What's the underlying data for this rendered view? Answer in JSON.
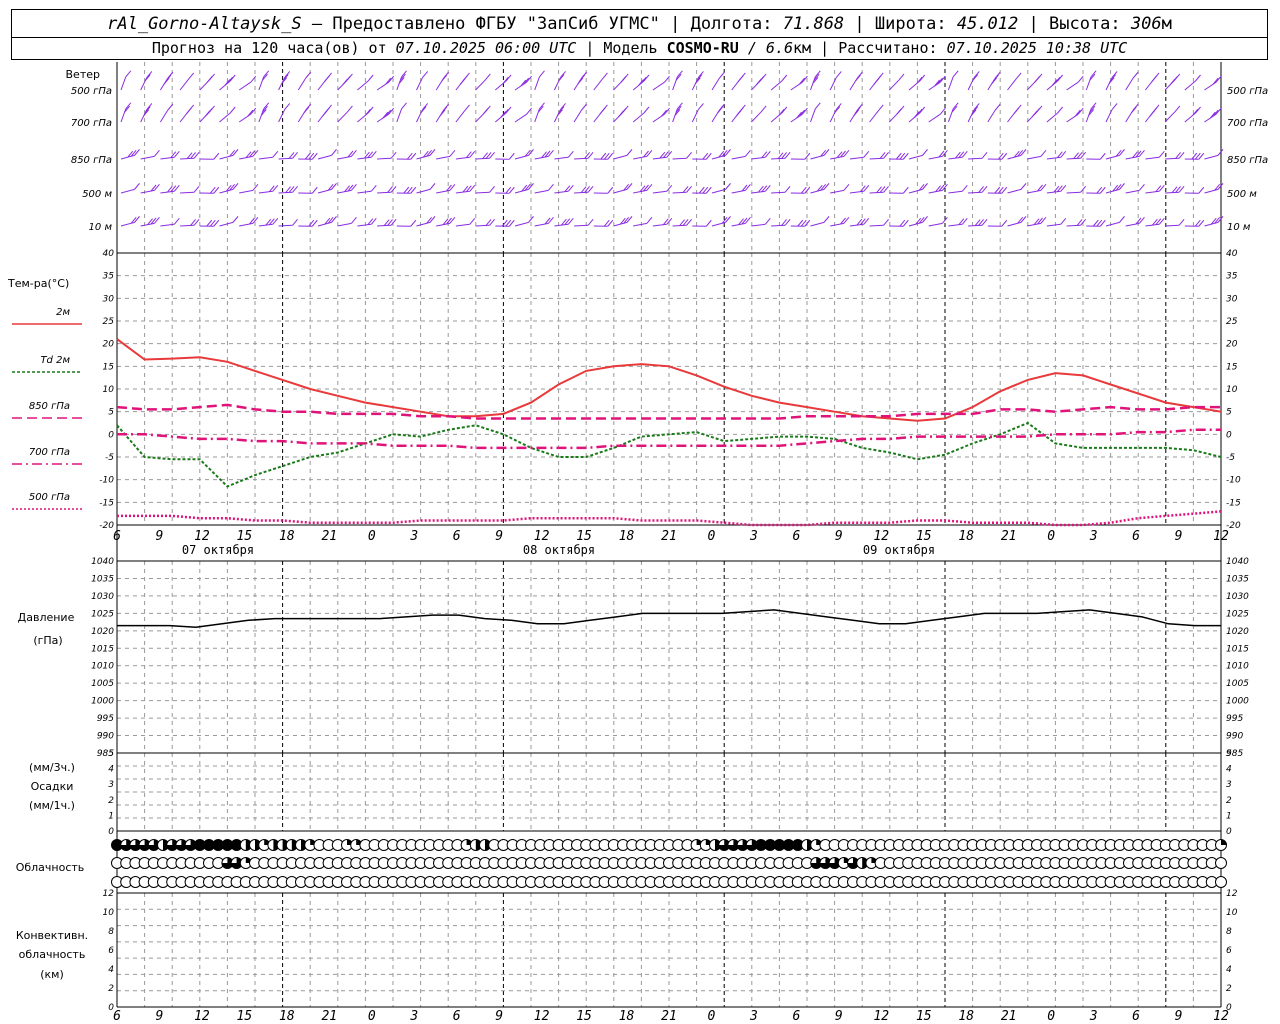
{
  "header": {
    "station": "rAl_Gorno-Altaysk_S",
    "dash": "–",
    "provider": "Предоставлено ФГБУ \"ЗапСиб УГМС\"",
    "lon_label": "Долгота:",
    "lon_value": "71.868",
    "lat_label": "Широта:",
    "lat_value": "45.012",
    "alt_label": "Высота:",
    "alt_value": "306",
    "alt_unit": "м",
    "forecast_label": "Прогноз на 120 часа(ов) от",
    "forecast_start": "07.10.2025 06:00 UTC",
    "model_label": "Модель",
    "model_name": "COSMO-RU",
    "model_res": "/ 6.6",
    "model_res_unit": "км",
    "calc_label": "Рассчитано:",
    "calc_time": "07.10.2025 10:38 UTC",
    "sep": "|"
  },
  "panels": {
    "wind": {
      "title": "Ветер",
      "levels": [
        "500 гПа",
        "700 гПа",
        "850 гПа",
        "500 м",
        "10 м"
      ]
    },
    "temperature": {
      "title": "Тем-ра(°C)",
      "legend": [
        {
          "label": "2м",
          "color": "#e8393b",
          "style": "solid"
        },
        {
          "label": "Td  2м",
          "color": "#1a7a1a",
          "style": "dotted"
        },
        {
          "label": "850 гПа",
          "color": "#e0137a",
          "style": "dashed"
        },
        {
          "label": "700 гПа",
          "color": "#e0137a",
          "style": "dashdot"
        },
        {
          "label": "500 гПа",
          "color": "#e0137a",
          "style": "dot"
        }
      ],
      "yticks": [
        "40",
        "35",
        "30",
        "25",
        "20",
        "15",
        "10",
        "5",
        "0",
        "-5",
        "-10",
        "-15",
        "-20"
      ]
    },
    "pressure": {
      "title1": "Давление",
      "title2": "(гПа)",
      "yticks": [
        "1040",
        "1035",
        "1030",
        "1025",
        "1020",
        "1015",
        "1010",
        "1005",
        "1000",
        "995",
        "990",
        "985"
      ]
    },
    "precip": {
      "title1": "(мм/3ч.)",
      "title2": "Осадки",
      "title3": "(мм/1ч.)",
      "yticks": [
        "5",
        "4",
        "3",
        "2",
        "1",
        "0"
      ]
    },
    "cloud": {
      "title": "Облачность"
    },
    "convective": {
      "title1": "Конвективн.",
      "title2": "облачность",
      "title3": "(км)",
      "yticks": [
        "12",
        "10",
        "8",
        "6",
        "4",
        "2",
        "0"
      ]
    }
  },
  "time_axis": {
    "hour_labels": [
      "6",
      "9",
      "12",
      "15",
      "18",
      "21",
      "0",
      "3",
      "6",
      "9",
      "12",
      "15",
      "18",
      "21",
      "0",
      "3",
      "6",
      "9",
      "12",
      "15",
      "18",
      "21",
      "0",
      "3",
      "6",
      "9",
      "12"
    ],
    "day_labels": [
      "07 октября",
      "08 октября",
      "09 октября"
    ]
  },
  "chart_data": {
    "type": "line",
    "x_hours_from_start": [
      0,
      3,
      6,
      9,
      12,
      15,
      18,
      21,
      24,
      27,
      30,
      33,
      36,
      39,
      42,
      45,
      48,
      51,
      54,
      57,
      60,
      63,
      66,
      69,
      72,
      75,
      78,
      81,
      84,
      87,
      90,
      93,
      96,
      99,
      102,
      105,
      108,
      111,
      114,
      117,
      120
    ],
    "series": [
      {
        "name": "2м",
        "color": "#e8393b",
        "values": [
          21,
          16.5,
          16.7,
          17,
          16,
          14,
          12,
          10,
          8.5,
          7,
          6,
          5,
          4,
          4,
          4.5,
          7,
          11,
          14,
          15,
          15.5,
          15,
          13,
          10.5,
          8.5,
          7,
          6,
          5,
          4,
          3.5,
          3,
          3.5,
          6,
          9.5,
          12,
          13.5,
          13,
          11,
          9,
          7,
          6,
          5
        ]
      },
      {
        "name": "Td  2м",
        "color": "#1a7a1a",
        "values": [
          2,
          -5,
          -5.5,
          -5.5,
          -11.5,
          -9,
          -7,
          -5,
          -4,
          -2,
          0,
          -0.5,
          1,
          2,
          0,
          -3,
          -5,
          -5,
          -3,
          -0.5,
          0,
          0.5,
          -1.5,
          -1,
          -0.5,
          -0.5,
          -1,
          -3,
          -4,
          -5.5,
          -4.5,
          -2,
          0,
          2.5,
          -2,
          -3,
          -3,
          -3,
          -3,
          -3.5,
          -5
        ]
      },
      {
        "name": "850 гПа",
        "color": "#e0137a",
        "values": [
          6,
          5.5,
          5.5,
          6,
          6.5,
          5.5,
          5,
          5,
          4.5,
          4.5,
          4.5,
          4,
          4,
          3.5,
          3.5,
          3.5,
          3.5,
          3.5,
          3.5,
          3.5,
          3.5,
          3.5,
          3.5,
          3.5,
          3.5,
          4,
          4,
          4,
          4,
          4.5,
          4.5,
          4.5,
          5.5,
          5.5,
          5,
          5.5,
          6,
          5.5,
          5.5,
          6,
          6
        ]
      },
      {
        "name": "700 гПа",
        "color": "#e0137a",
        "values": [
          0,
          0,
          -0.5,
          -1,
          -1,
          -1.5,
          -1.5,
          -2,
          -2,
          -2,
          -2.5,
          -2.5,
          -2.5,
          -3,
          -3,
          -3,
          -3,
          -3,
          -2.5,
          -2.5,
          -2.5,
          -2.5,
          -2.5,
          -2.5,
          -2.5,
          -2,
          -1.5,
          -1,
          -1,
          -0.5,
          -0.5,
          -0.5,
          -0.5,
          -0.5,
          0,
          0,
          0,
          0.5,
          0.5,
          1,
          1
        ]
      },
      {
        "name": "500 гПа",
        "color": "#e0137a",
        "values": [
          -18,
          -18,
          -18,
          -18.5,
          -18.5,
          -19,
          -19,
          -19.5,
          -19.5,
          -19.5,
          -19.5,
          -19,
          -19,
          -19,
          -19,
          -18.5,
          -18.5,
          -18.5,
          -18.5,
          -19,
          -19,
          -19,
          -19.5,
          -20,
          -20,
          -20,
          -19.5,
          -19.5,
          -19.5,
          -19,
          -19,
          -19.5,
          -19.5,
          -19.5,
          -20,
          -20,
          -19.5,
          -18.5,
          -18,
          -17.5,
          -17
        ]
      }
    ],
    "pressure": [
      1021.5,
      1021.5,
      1021.5,
      1021,
      1022,
      1023,
      1023.5,
      1023.5,
      1023.5,
      1023.5,
      1023.5,
      1024,
      1024.5,
      1024.5,
      1023.5,
      1023,
      1022,
      1022,
      1023,
      1024,
      1025,
      1025,
      1025,
      1025,
      1025.5,
      1026,
      1025,
      1024,
      1023,
      1022,
      1022,
      1023,
      1024,
      1025,
      1025,
      1025,
      1025.5,
      1026,
      1025,
      1024,
      1022,
      1021.5,
      1021.5
    ],
    "temp_ylim": [
      -20,
      40
    ],
    "pressure_ylim": [
      985,
      1040
    ],
    "precip_ylim": [
      0,
      5
    ],
    "convective_ylim": [
      0,
      13
    ],
    "grid": true,
    "wind_color": "#8a2be2",
    "cloud_cover": {
      "upper": [
        1,
        0.75,
        0.75,
        0.75,
        0.75,
        0.5,
        0.75,
        0.75,
        0.75,
        1,
        1,
        1,
        1,
        1,
        0.5,
        0.5,
        0.25,
        0.5,
        0.5,
        0.5,
        0.5,
        0.25,
        0,
        0,
        0,
        0.25,
        0.25,
        0,
        0,
        0,
        0,
        0,
        0,
        0,
        0,
        0,
        0,
        0,
        0.25,
        0.5,
        0.5,
        0,
        0,
        0,
        0,
        0,
        0,
        0,
        0,
        0,
        0,
        0,
        0,
        0,
        0,
        0,
        0,
        0,
        0,
        0,
        0,
        0,
        0,
        0.25,
        0.25,
        0.5,
        0.75,
        0.75,
        0.75,
        0.75,
        1,
        1,
        1,
        1,
        1,
        0.5,
        0.25,
        0,
        0,
        0,
        0,
        0,
        0,
        0,
        0,
        0,
        0,
        0,
        0,
        0,
        0,
        0,
        0,
        0,
        0,
        0,
        0,
        0,
        0,
        0,
        0,
        0,
        0,
        0,
        0,
        0,
        0,
        0,
        0,
        0,
        0,
        0,
        0,
        0,
        0,
        0,
        0,
        0,
        0,
        0,
        0.25
      ],
      "middle": [
        0,
        0,
        0,
        0,
        0,
        0,
        0,
        0,
        0,
        0,
        0,
        0,
        0.75,
        0.75,
        0.25,
        0,
        0,
        0,
        0,
        0,
        0,
        0,
        0,
        0,
        0,
        0,
        0,
        0,
        0,
        0,
        0,
        0,
        0,
        0,
        0,
        0,
        0,
        0,
        0,
        0,
        0,
        0,
        0,
        0,
        0,
        0,
        0,
        0,
        0,
        0,
        0,
        0,
        0,
        0,
        0,
        0,
        0,
        0,
        0,
        0,
        0,
        0,
        0,
        0,
        0,
        0,
        0,
        0,
        0,
        0,
        0,
        0,
        0,
        0,
        0,
        0,
        0.75,
        0.75,
        0.75,
        0.25,
        0.75,
        0.5,
        0.25,
        0,
        0,
        0,
        0,
        0,
        0,
        0,
        0,
        0,
        0,
        0,
        0,
        0,
        0,
        0,
        0,
        0,
        0,
        0,
        0,
        0,
        0,
        0,
        0,
        0,
        0,
        0,
        0,
        0,
        0,
        0,
        0,
        0,
        0,
        0,
        0,
        0,
        0
      ],
      "lower": []
    }
  }
}
